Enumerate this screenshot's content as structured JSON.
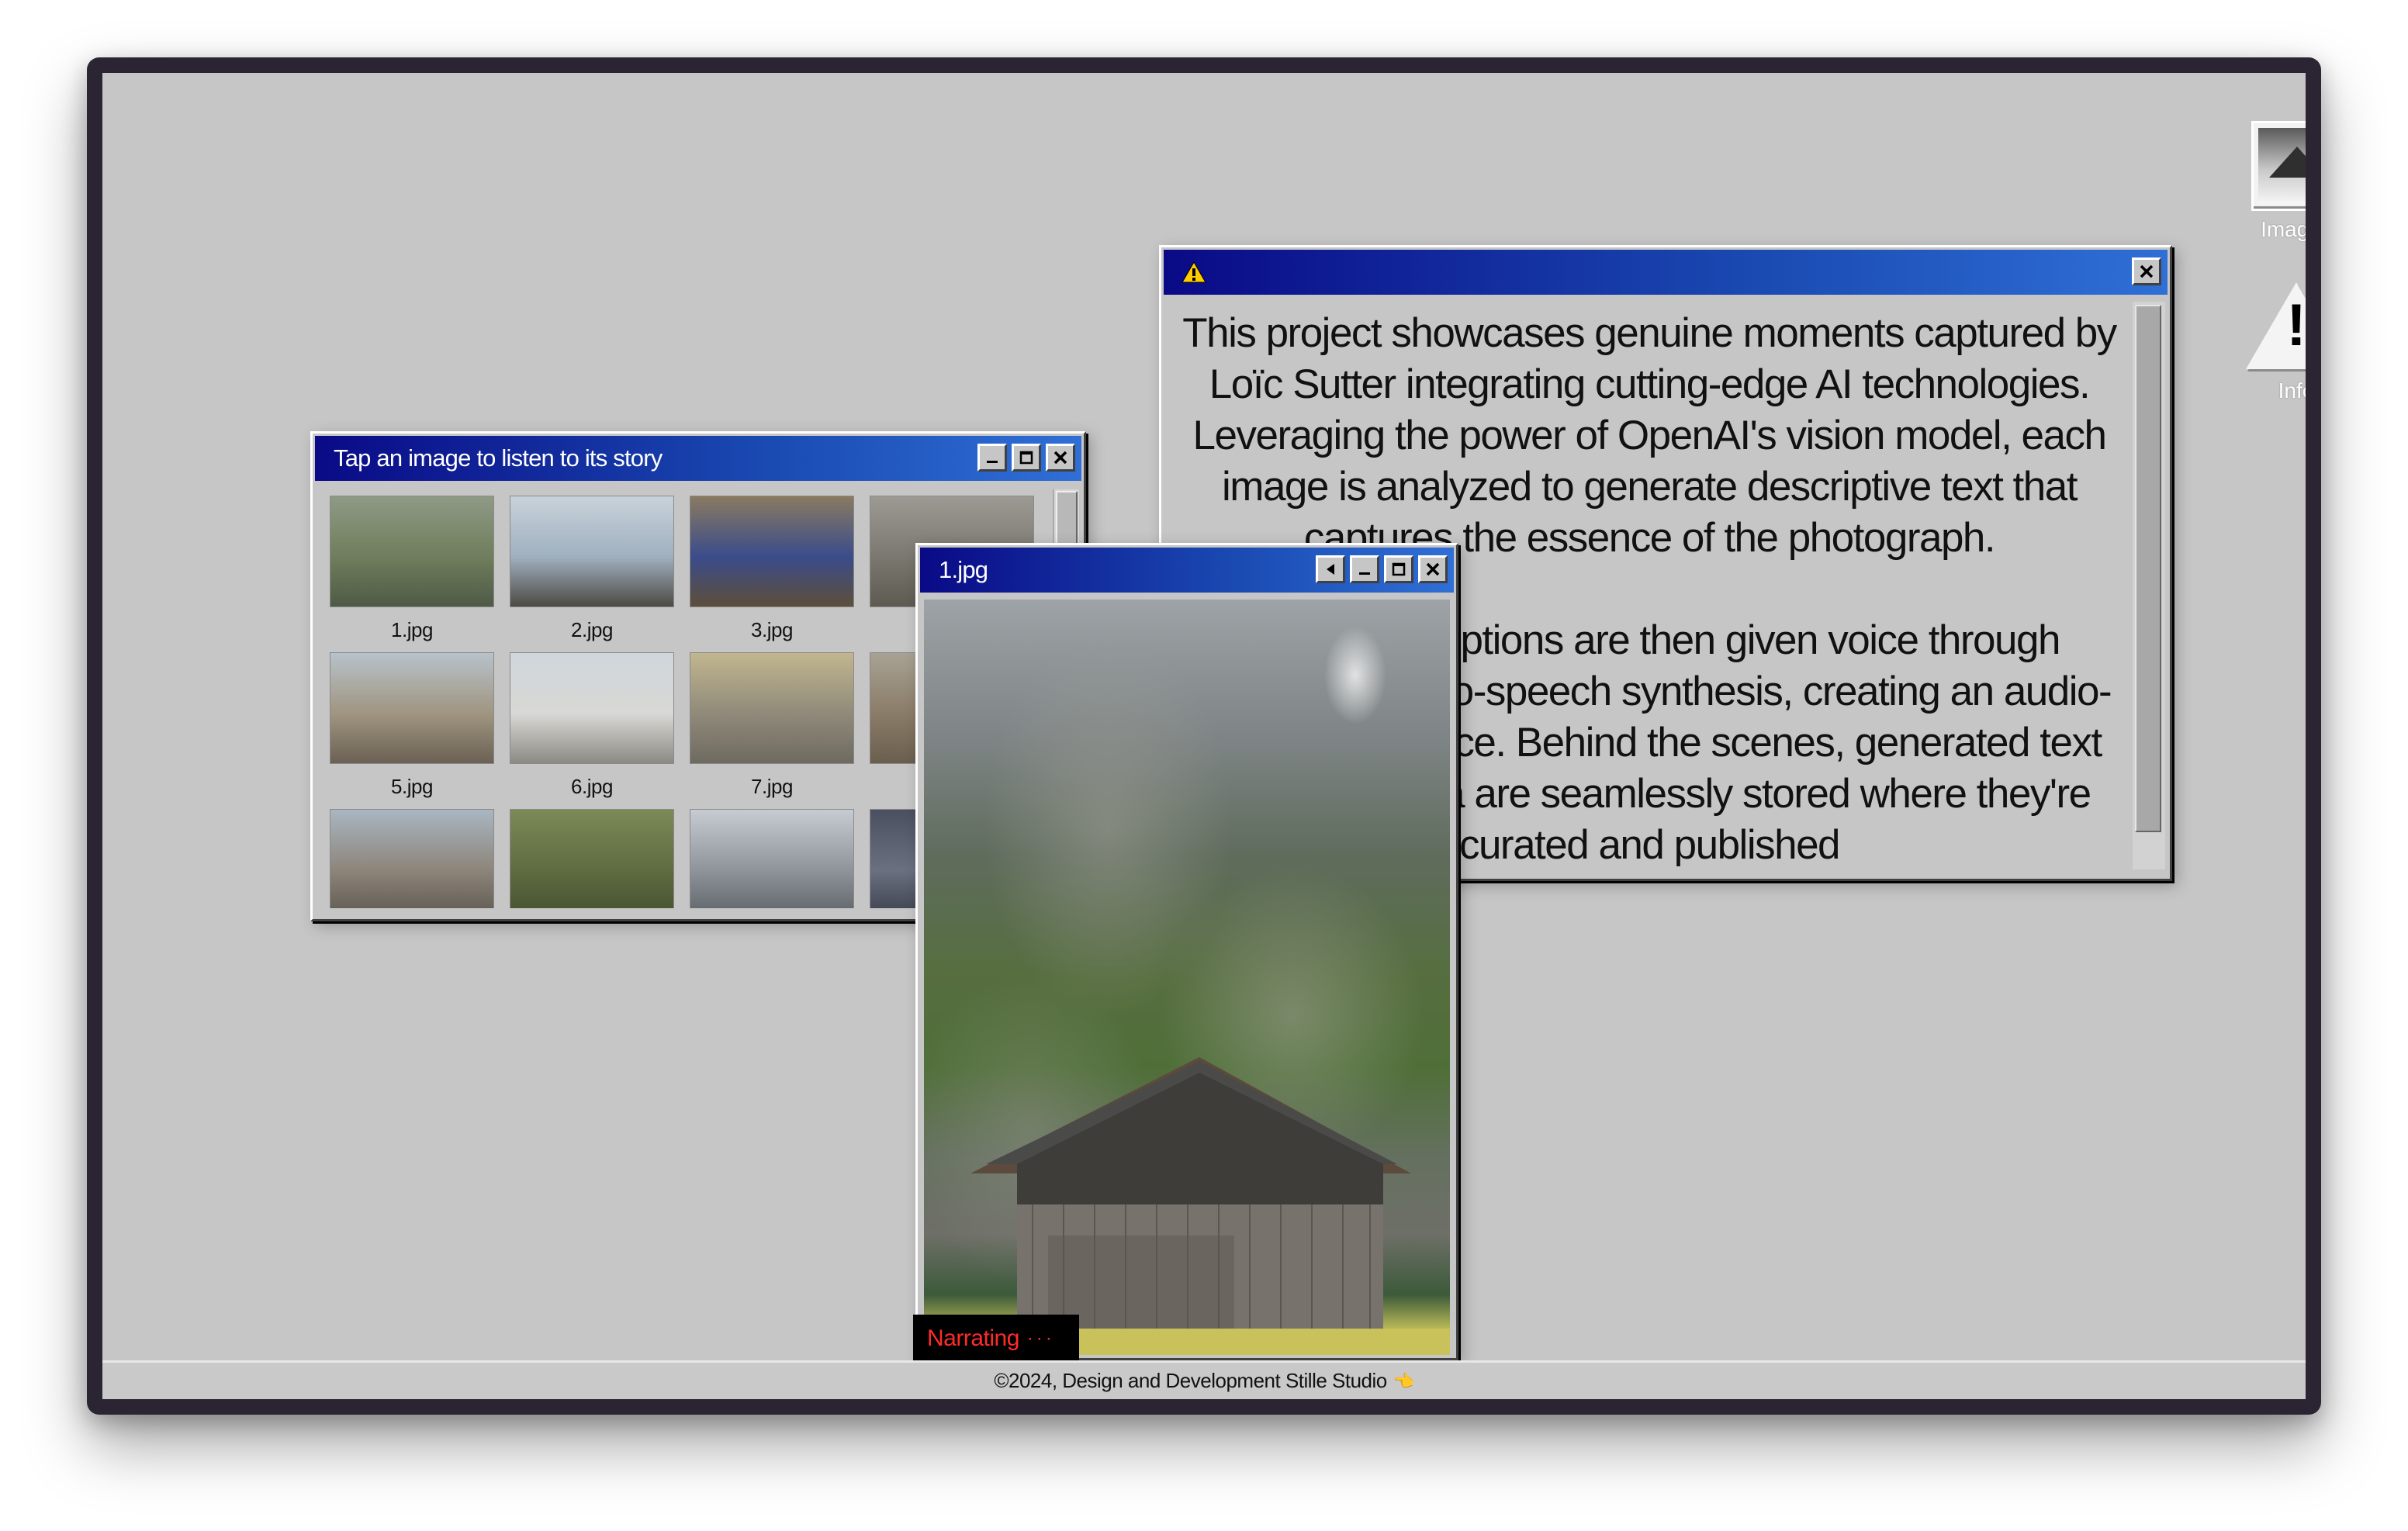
{
  "gallery": {
    "title": "Tap an image to listen to its story",
    "thumbnails": [
      {
        "caption": "1.jpg",
        "colors": [
          "#8f9a86",
          "#6f7e5c",
          "#4f5a46"
        ]
      },
      {
        "caption": "2.jpg",
        "colors": [
          "#c9d2da",
          "#9fb0bf",
          "#4d4a44"
        ]
      },
      {
        "caption": "3.jpg",
        "colors": [
          "#8a7a60",
          "#3a4c8a",
          "#5e4e3a"
        ]
      },
      {
        "caption": "",
        "colors": [
          "#9c9a94",
          "#7a786f",
          "#5e5a52"
        ]
      },
      {
        "caption": "5.jpg",
        "colors": [
          "#b7c2cb",
          "#a09580",
          "#6a6154"
        ]
      },
      {
        "caption": "6.jpg",
        "colors": [
          "#cfd6dc",
          "#d8d8d4",
          "#8c8a84"
        ]
      },
      {
        "caption": "7.jpg",
        "colors": [
          "#c2b68f",
          "#8f8a7a",
          "#6f6a60"
        ]
      },
      {
        "caption": "",
        "colors": [
          "#a8a294",
          "#8a7c68",
          "#6a5e4e"
        ]
      },
      {
        "caption": "",
        "colors": [
          "#a9b6c2",
          "#8d857a",
          "#5c564e"
        ]
      },
      {
        "caption": "",
        "colors": [
          "#7c8a58",
          "#5e6c40",
          "#454f30"
        ]
      },
      {
        "caption": "",
        "colors": [
          "#c7ccd2",
          "#8e949a",
          "#5a6066"
        ]
      },
      {
        "caption": "",
        "colors": [
          "#4a5060",
          "#6a7080",
          "#3a3e4a"
        ]
      }
    ]
  },
  "info": {
    "paragraph1": "This project showcases genuine moments captured by Loïc Sutter integrating cutting-edge AI technologies. Leveraging the power of OpenAI's vision model, each image is analyzed to generate descriptive text that captures the essence of the photograph.",
    "paragraph2": "These descriptions are then given voice through advanced text-to-speech synthesis, creating an audio-visual experience. Behind the scenes, generated text and audio data are seamlessly stored where they're curated and published"
  },
  "photo": {
    "title": "1.jpg",
    "status": "Narrating",
    "status_dots": "···"
  },
  "desktop_icons": {
    "images_label": "Images",
    "info_label": "Info",
    "info_glyph": "!"
  },
  "footer": {
    "text": "©2024, Design and Development Stille Studio",
    "hand": "👈"
  },
  "colors": {
    "desktop_bg": "#c6c6c6",
    "titlebar_start": "#0a0a86",
    "titlebar_end": "#2f6fd6",
    "narrating_text": "#ff2b2b",
    "frame": "#2b2533"
  }
}
